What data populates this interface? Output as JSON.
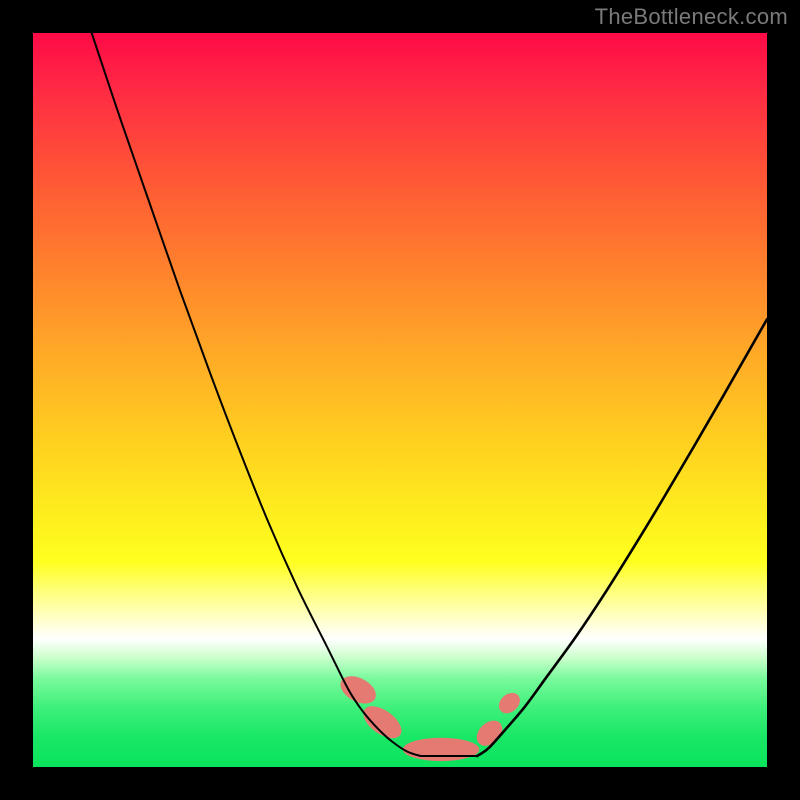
{
  "watermark": "TheBottleneck.com",
  "colors": {
    "frame": "#000000",
    "curve": "#000000",
    "accent": "#e57a73",
    "gradient_top": "#ff0a47",
    "gradient_bottom": "#0be35d"
  },
  "chart_data": {
    "type": "line",
    "title": "",
    "xlabel": "",
    "ylabel": "",
    "xlim": [
      0,
      100
    ],
    "ylim": [
      0,
      100
    ],
    "series": [
      {
        "name": "left-curve",
        "x": [
          8,
          12,
          16,
          20,
          24,
          28,
          32,
          36,
          40,
          43,
          45,
          47,
          49,
          51,
          52.8
        ],
        "values": [
          100,
          88,
          76.5,
          65,
          54,
          43.5,
          33.5,
          24.5,
          16.5,
          10.5,
          7.5,
          5.2,
          3.4,
          2.1,
          1.5
        ]
      },
      {
        "name": "right-curve",
        "x": [
          60.5,
          62,
          64,
          67,
          70,
          74,
          78,
          82,
          86,
          90,
          94,
          98,
          100
        ],
        "values": [
          1.5,
          2.5,
          4.7,
          8.2,
          12.3,
          17.8,
          23.8,
          30.2,
          36.8,
          43.6,
          50.5,
          57.5,
          61
        ]
      },
      {
        "name": "floor",
        "x": [
          52.8,
          60.5
        ],
        "values": [
          1.5,
          1.5
        ]
      }
    ],
    "annotations": [
      {
        "name": "accent-blob-left-upper",
        "cx": 44.3,
        "cy": 10.5,
        "rx": 1.6,
        "ry": 2.6,
        "rotation": -62
      },
      {
        "name": "accent-blob-left-lower",
        "cx": 47.6,
        "cy": 6.1,
        "rx": 1.6,
        "ry": 3.0,
        "rotation": -54
      },
      {
        "name": "accent-blob-floor",
        "cx": 55.6,
        "cy": 2.4,
        "rx": 5.2,
        "ry": 1.6,
        "rotation": 0
      },
      {
        "name": "accent-blob-right-lower",
        "cx": 62.2,
        "cy": 4.6,
        "rx": 1.4,
        "ry": 2.0,
        "rotation": 46
      },
      {
        "name": "accent-blob-right-upper",
        "cx": 64.9,
        "cy": 8.7,
        "rx": 1.2,
        "ry": 1.6,
        "rotation": 48
      }
    ]
  }
}
